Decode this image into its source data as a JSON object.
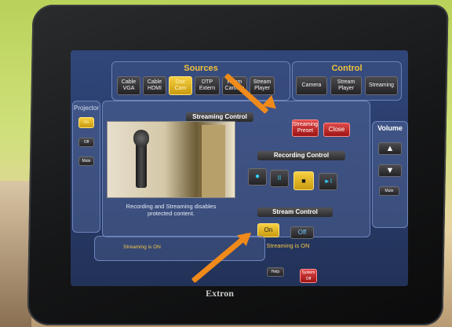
{
  "device": {
    "brand": "Extron"
  },
  "sources": {
    "title": "Sources",
    "buttons": [
      "Cable VGA",
      "Cable HDMI",
      "Doc Cam",
      "DTP Extern",
      "Room Camera",
      "Stream Player"
    ]
  },
  "control": {
    "title": "Control",
    "buttons": [
      "Camera",
      "Stream Player",
      "Streaming"
    ]
  },
  "projector": {
    "title": "Projector",
    "on": "On",
    "off": "Off",
    "mute": "Mute"
  },
  "streaming_control": {
    "title": "Streaming Control",
    "preset": "Streaming Preset",
    "close": "Close",
    "note": "Recording and Streaming disables protected content."
  },
  "recording_control": {
    "title": "Recording Control",
    "buttons": [
      "●",
      "II",
      "■",
      "►I"
    ]
  },
  "stream_control": {
    "title": "Stream Control",
    "on": "On",
    "off": "Off",
    "status": "Streaming is ON"
  },
  "volume": {
    "title": "Volume",
    "up": "▲",
    "down": "▼",
    "mute": "Mute"
  },
  "footer": {
    "status": "Streaming is ON",
    "help": "Help",
    "system_off": "System Off"
  },
  "colors": {
    "accent": "#f0c23b",
    "arrow": "#f08a1a",
    "screen_bg": "#2b3f6e"
  }
}
